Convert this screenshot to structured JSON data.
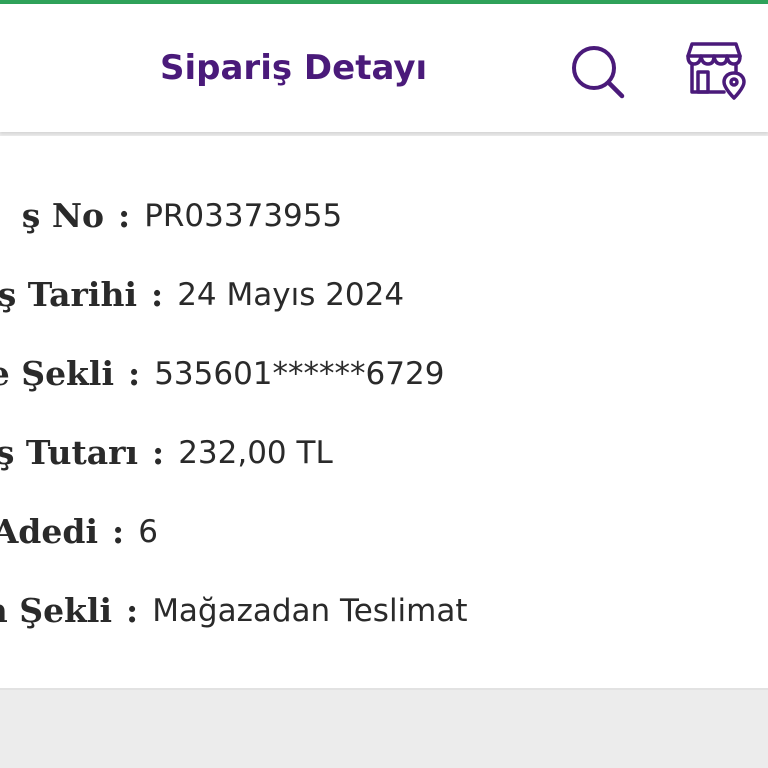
{
  "header": {
    "title": "Sipariş Detayı",
    "icons": [
      "search-icon",
      "store-location-icon"
    ],
    "accent_color": "#4a1a7a",
    "top_strip_color": "#2fa25a"
  },
  "order_details": [
    {
      "label": "ş No",
      "value": "PR03373955"
    },
    {
      "label": "ş Tarihi",
      "value": "24 Mayıs 2024"
    },
    {
      "label": "e Şekli",
      "value": "535601******6729"
    },
    {
      "label": "ş Tutarı",
      "value": "232,00 TL"
    },
    {
      "label": "Adedi",
      "value": "6"
    },
    {
      "label": "n Şekli",
      "value": "Mağazadan Teslimat"
    }
  ],
  "separator": ":"
}
